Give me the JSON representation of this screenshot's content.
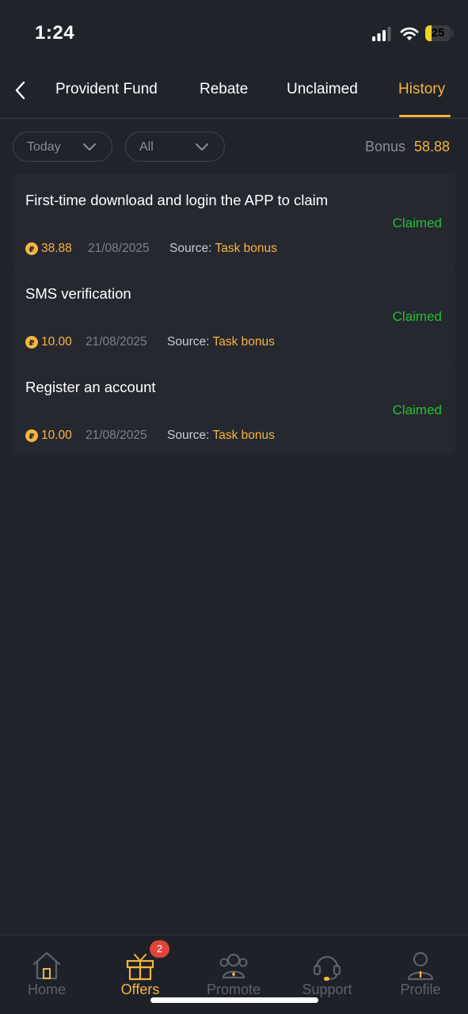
{
  "status_bar": {
    "time": "1:24",
    "battery": "25",
    "battery_level": 0.25
  },
  "tabs": [
    {
      "label": "Provident Fund",
      "active": false
    },
    {
      "label": "Rebate",
      "active": false
    },
    {
      "label": "Unclaimed",
      "active": false
    },
    {
      "label": "History",
      "active": true
    }
  ],
  "filters": {
    "date": "Today",
    "type": "All"
  },
  "bonus": {
    "label": "Bonus",
    "value": "58.88"
  },
  "records": [
    {
      "title": "First-time download and login the APP to claim",
      "status": "Claimed",
      "amount": "38.88",
      "date": "21/08/2025",
      "source_label": "Source:",
      "source": "Task bonus"
    },
    {
      "title": "SMS verification",
      "status": "Claimed",
      "amount": "10.00",
      "date": "21/08/2025",
      "source_label": "Source:",
      "source": "Task bonus"
    },
    {
      "title": "Register an account",
      "status": "Claimed",
      "amount": "10.00",
      "date": "21/08/2025",
      "source_label": "Source:",
      "source": "Task bonus"
    }
  ],
  "nav": [
    {
      "label": "Home",
      "icon": "home-icon",
      "active": false
    },
    {
      "label": "Offers",
      "icon": "gift-icon",
      "active": true,
      "badge": "2"
    },
    {
      "label": "Promote",
      "icon": "people-icon",
      "active": false
    },
    {
      "label": "Support",
      "icon": "headset-icon",
      "active": false
    },
    {
      "label": "Profile",
      "icon": "person-icon",
      "active": false
    }
  ],
  "colors": {
    "background": "#21232b",
    "accent": "#f5b53d",
    "success": "#21c031",
    "badge": "#e0443a"
  }
}
